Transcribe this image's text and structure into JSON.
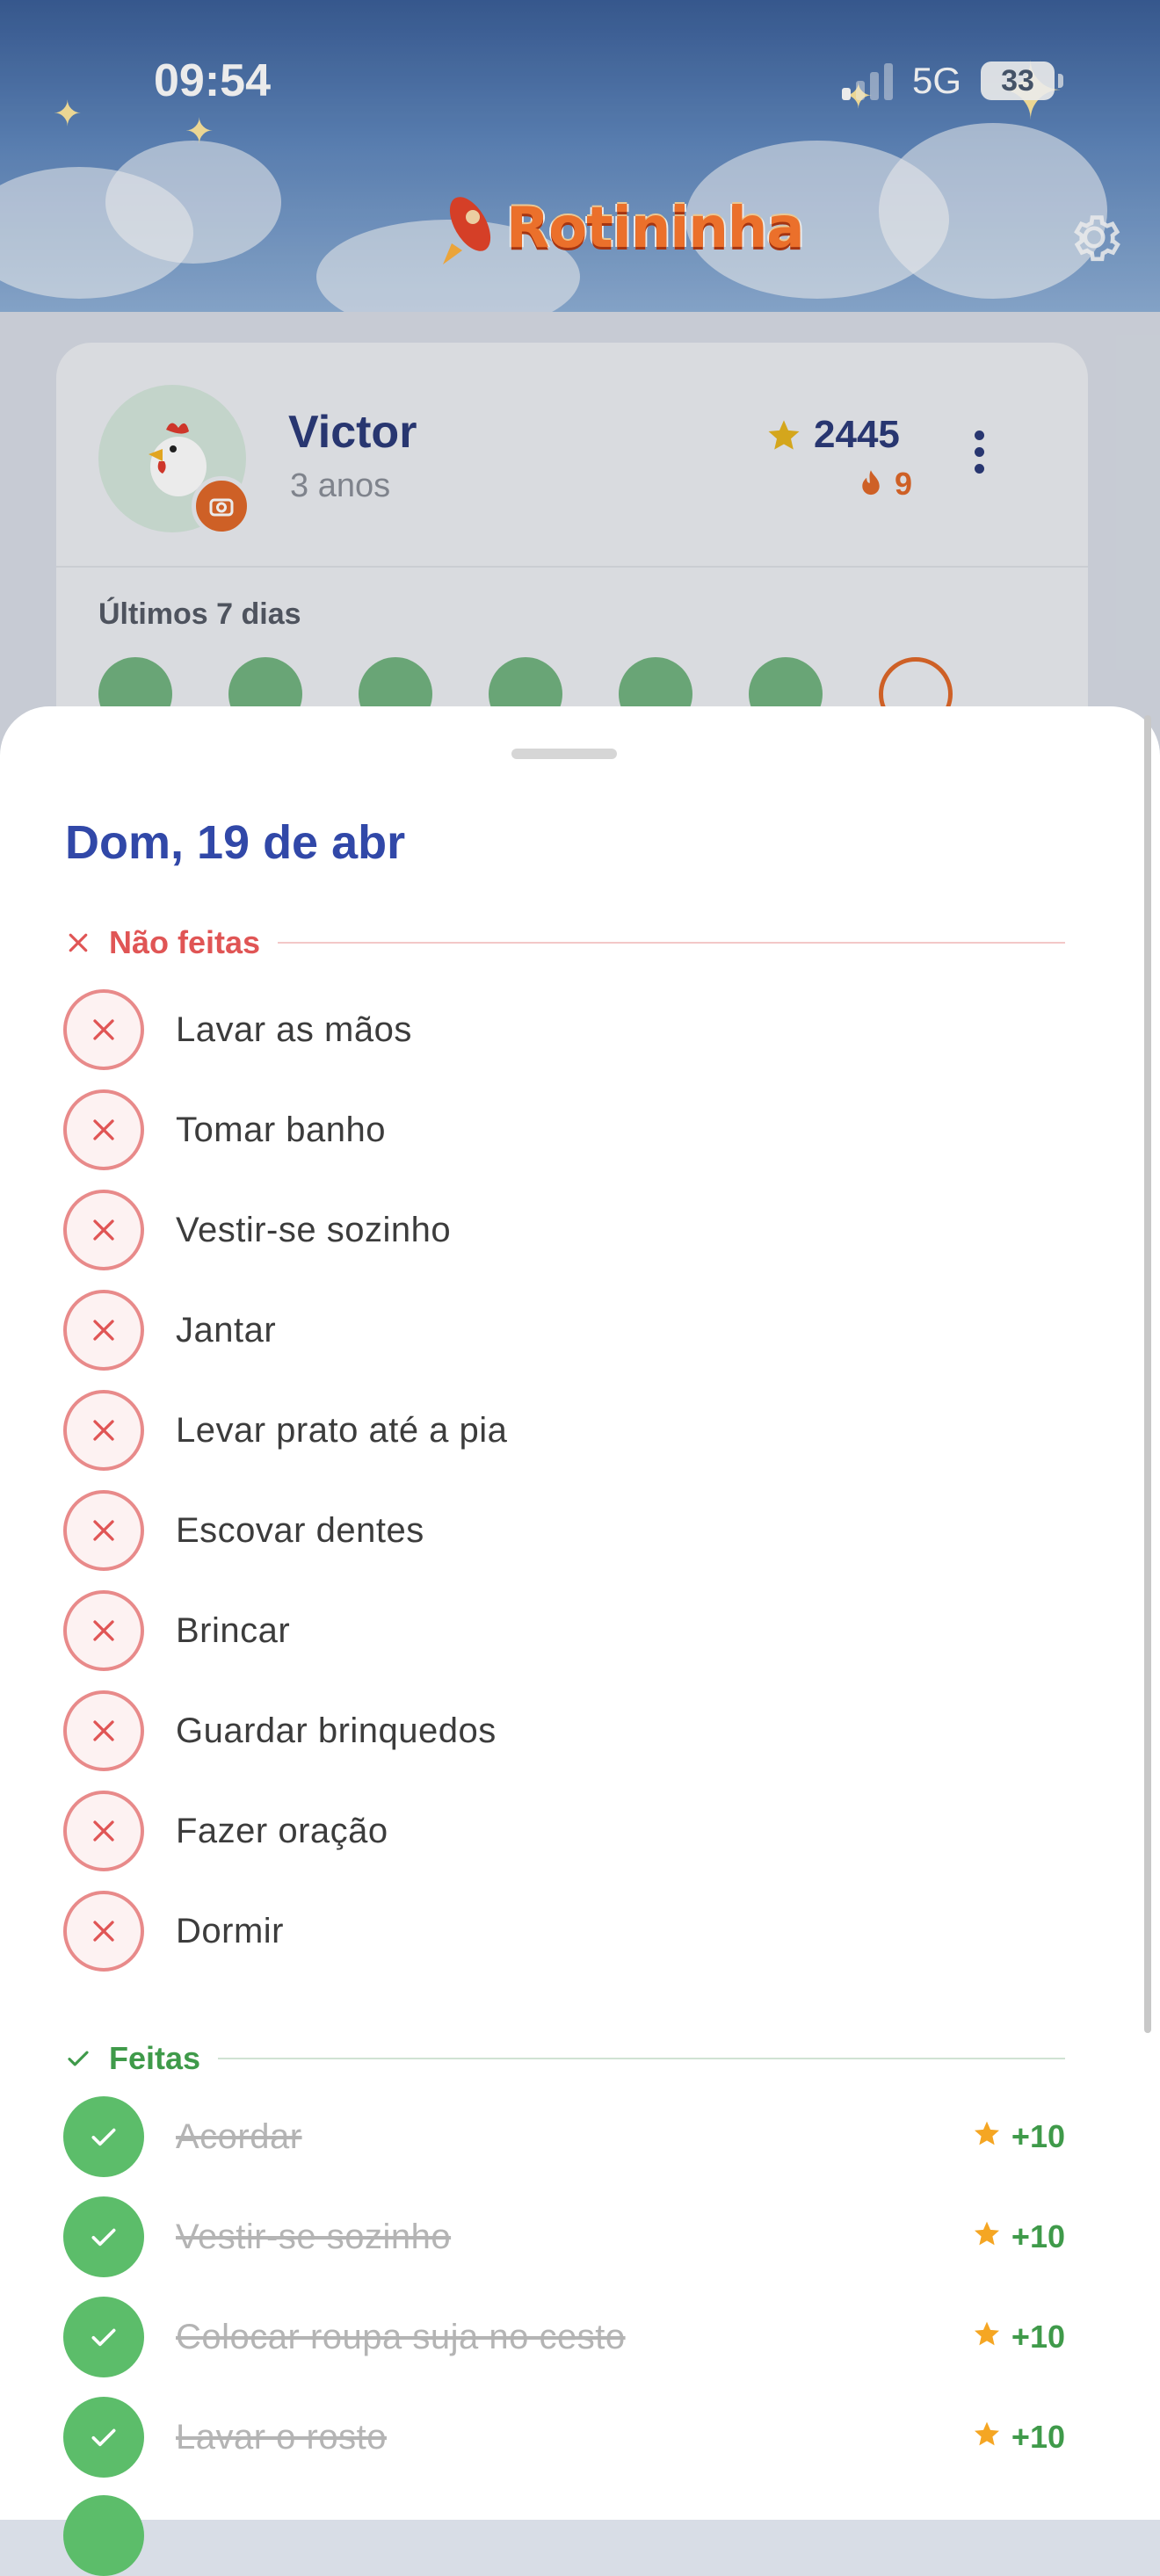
{
  "status_bar": {
    "time": "09:54",
    "network": "5G",
    "battery": "33"
  },
  "header": {
    "app_name": "Rotininha"
  },
  "profile": {
    "name": "Victor",
    "age": "3 anos",
    "points": "2445",
    "streak": "9",
    "last7_label": "Últimos 7 dias",
    "days": [
      {
        "state": "done"
      },
      {
        "state": "done"
      },
      {
        "state": "done"
      },
      {
        "state": "done"
      },
      {
        "state": "done"
      },
      {
        "state": "done"
      },
      {
        "state": "today"
      }
    ]
  },
  "sheet": {
    "title": "Dom, 19 de abr",
    "undone_label": "Não feitas",
    "undone": [
      "Lavar as mãos",
      "Tomar banho",
      "Vestir-se sozinho",
      "Jantar",
      "Levar prato até a pia",
      "Escovar dentes",
      "Brincar",
      "Guardar brinquedos",
      "Fazer oração",
      "Dormir"
    ],
    "done_label": "Feitas",
    "done": [
      {
        "label": "Acordar",
        "points": "+10"
      },
      {
        "label": "Vestir-se sozinho",
        "points": "+10"
      },
      {
        "label": "Colocar roupa suja no cesto",
        "points": "+10"
      },
      {
        "label": "Lavar o rosto",
        "points": "+10"
      }
    ]
  },
  "colors": {
    "accent": "#3148a8",
    "undone": "#e05555",
    "done": "#5cbd6a",
    "star": "#f5a623",
    "flame": "#e0692a"
  }
}
